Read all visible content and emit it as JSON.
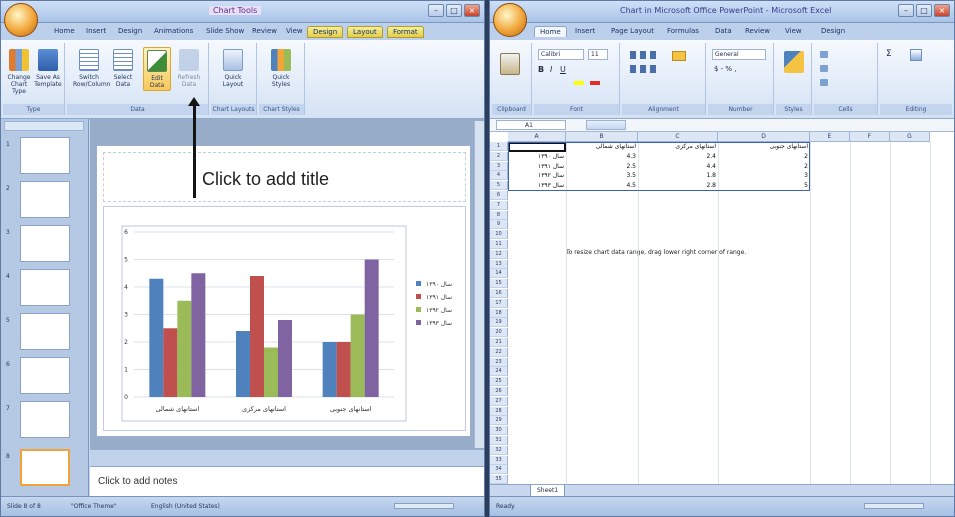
{
  "powerpoint": {
    "title": "Chart Tools",
    "tabs": [
      "Home",
      "Insert",
      "Design",
      "Animations",
      "Slide Show",
      "Review",
      "View",
      "Design",
      "Layout",
      "Format"
    ],
    "groups": {
      "type": "Type",
      "data": "Data",
      "chart_layouts": "Chart Layouts",
      "chart_styles": "Chart Styles"
    },
    "buttons": {
      "change_chart_type": "Change Chart Type",
      "save_as_template": "Save As Template",
      "switch_row_column": "Switch Row/Column",
      "select_data": "Select Data",
      "edit_data": "Edit Data",
      "refresh_data": "Refresh Data",
      "quick_layout": "Quick Layout",
      "quick_styles": "Quick Styles"
    },
    "slide_title_placeholder": "Click to add title",
    "notes_placeholder": "Click to add notes",
    "status_left": "Slide 8 of 8",
    "status_theme": "\"Office Theme\"",
    "status_lang": "English (United States)"
  },
  "excel": {
    "title": "Chart in Microsoft Office PowerPoint - Microsoft Excel",
    "tabs": [
      "Home",
      "Insert",
      "Page Layout",
      "Formulas",
      "Data",
      "Review",
      "View",
      "Design"
    ],
    "groups": {
      "clipboard": "Clipboard",
      "font": "Font",
      "alignment": "Alignment",
      "number": "Number",
      "styles": "Styles",
      "cells": "Cells",
      "editing": "Editing"
    },
    "font_name": "Calibri",
    "font_size": "11",
    "number_format": "General",
    "name_box": "A1",
    "columns": [
      "A",
      "B",
      "C",
      "D",
      "E",
      "F",
      "G"
    ],
    "rows": [
      "1",
      "2",
      "3",
      "4",
      "5",
      "6",
      "7",
      "8",
      "9",
      "10",
      "11",
      "12",
      "13",
      "14",
      "15",
      "16",
      "17",
      "18",
      "19",
      "20",
      "21",
      "22",
      "23",
      "24",
      "25",
      "26",
      "27",
      "28",
      "29",
      "30",
      "31",
      "32",
      "33",
      "34",
      "35"
    ],
    "header_row": [
      "",
      "استانهای شمالی",
      "استانهای مرکزی",
      "استانهای جنوبی"
    ],
    "data_rows": [
      [
        "سال ۱۳۹۰",
        "4.3",
        "2.4",
        "2"
      ],
      [
        "سال ۱۳۹۱",
        "2.5",
        "4.4",
        "2"
      ],
      [
        "سال ۱۳۹۲",
        "3.5",
        "1.8",
        "3"
      ],
      [
        "سال ۱۳۹۳",
        "4.5",
        "2.8",
        "5"
      ]
    ],
    "note": "To resize chart data range, drag lower right corner of range.",
    "sheet_tab": "Sheet1",
    "status": "Ready"
  },
  "chart_data": {
    "type": "bar",
    "categories": [
      "استانهای شمالی",
      "استانهای مرکزی",
      "استانهای جنوبی"
    ],
    "series": [
      {
        "name": "سال ۱۳۹۰",
        "values": [
          4.3,
          2.4,
          2
        ],
        "color": "#4f81bd"
      },
      {
        "name": "سال ۱۳۹۱",
        "values": [
          2.5,
          4.4,
          2
        ],
        "color": "#c0504d"
      },
      {
        "name": "سال ۱۳۹۲",
        "values": [
          3.5,
          1.8,
          3
        ],
        "color": "#9bbb59"
      },
      {
        "name": "سال ۱۳۹۳",
        "values": [
          4.5,
          2.8,
          5
        ],
        "color": "#8064a2"
      }
    ],
    "yticks": [
      "0",
      "1",
      "2",
      "3",
      "4",
      "5",
      "6"
    ],
    "ylim": [
      0,
      6
    ],
    "grid": true,
    "legend": "right"
  }
}
